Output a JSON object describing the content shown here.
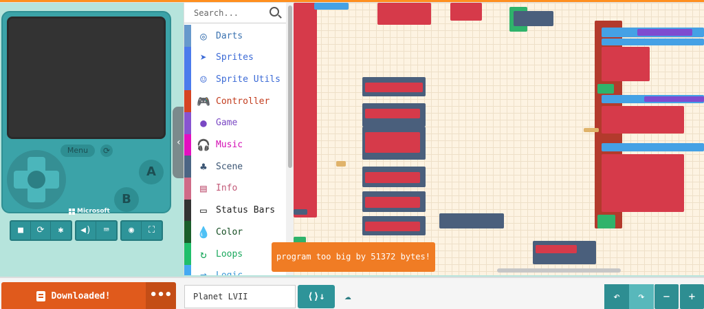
{
  "simulator": {
    "menu_label": "Menu",
    "button_a": "A",
    "button_b": "B",
    "brand": "Microsoft",
    "tools": [
      {
        "name": "stop-icon",
        "glyph": "■"
      },
      {
        "name": "restart-icon",
        "glyph": "⟳"
      },
      {
        "name": "debug-icon",
        "glyph": "✱"
      },
      {
        "name": "sound-icon",
        "glyph": "◀)"
      },
      {
        "name": "keyboard-icon",
        "glyph": "⌨"
      },
      {
        "name": "screenshot-icon",
        "glyph": "◉"
      },
      {
        "name": "fullscreen-icon",
        "glyph": "⛶"
      }
    ]
  },
  "toolbox": {
    "search_placeholder": "Search...",
    "categories": [
      {
        "label": "Darts",
        "color": "#6699cc",
        "text_color": "#3a72b0",
        "icon": "◎"
      },
      {
        "label": "Sprites",
        "color": "#4b7bec",
        "text_color": "#3b6ad6",
        "icon": "➤"
      },
      {
        "label": "Sprite Utils",
        "color": "#4b7bec",
        "text_color": "#3b6ad6",
        "icon": "☺"
      },
      {
        "label": "Controller",
        "color": "#d54322",
        "text_color": "#c23b1c",
        "icon": "🎮"
      },
      {
        "label": "Game",
        "color": "#8854d0",
        "text_color": "#7a48c4",
        "icon": "●"
      },
      {
        "label": "Music",
        "color": "#e30fc0",
        "text_color": "#d40db4",
        "icon": "🎧"
      },
      {
        "label": "Scene",
        "color": "#4b6584",
        "text_color": "#3c5674",
        "icon": "♣"
      },
      {
        "label": "Info",
        "color": "#cf6a87",
        "text_color": "#c25a78",
        "icon": "▤"
      },
      {
        "label": "Status Bars",
        "color": "#333333",
        "text_color": "#222222",
        "icon": "▭"
      },
      {
        "label": "Color",
        "color": "#1a5e2a",
        "text_color": "#144d22",
        "icon": "💧"
      },
      {
        "label": "Loops",
        "color": "#20bf6b",
        "text_color": "#1aa85d",
        "icon": "↻"
      },
      {
        "label": "Logic",
        "color": "#45aaf2",
        "text_color": "#3996d6",
        "icon": "⇄"
      }
    ]
  },
  "workspace": {
    "toast": "program too big by 51372 bytes!"
  },
  "bottombar": {
    "download_label": "Downloaded!",
    "more_label": "•••",
    "project_name": "Planet LVII",
    "github_label": "⟨⟩↓",
    "undo_glyph": "↶",
    "redo_glyph": "↷",
    "zoom_out_glyph": "−",
    "zoom_in_glyph": "+"
  }
}
